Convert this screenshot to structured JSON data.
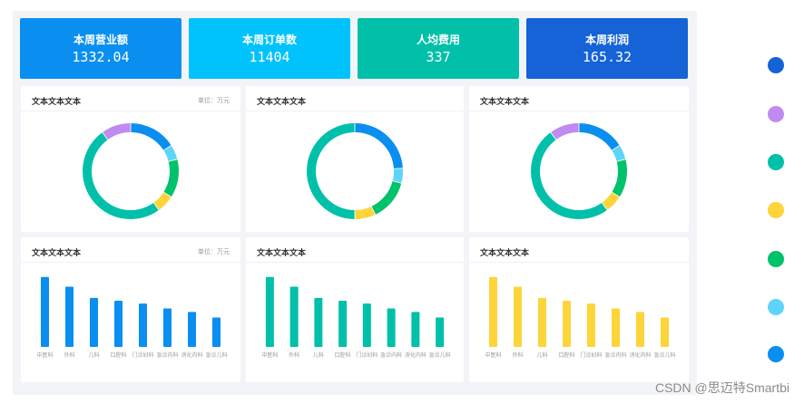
{
  "kpis": [
    {
      "title": "本周营业额",
      "value": "1332.04",
      "color": "#0a8ff0"
    },
    {
      "title": "本周订单数",
      "value": "11404",
      "color": "#00c2fc"
    },
    {
      "title": "人均费用",
      "value": "337",
      "color": "#00c0a9"
    },
    {
      "title": "本周利润",
      "value": "165.32",
      "color": "#1563d6"
    }
  ],
  "donut_cards": [
    {
      "title": "文本文本文本",
      "unit": "单位：万元"
    },
    {
      "title": "文本文本文本",
      "unit": ""
    },
    {
      "title": "文本文本文本",
      "unit": ""
    }
  ],
  "bar_cards": [
    {
      "title": "文本文本文本",
      "unit": "单位：万元",
      "color": "#0a8ff0"
    },
    {
      "title": "文本文本文本",
      "unit": "",
      "color": "#00c0a9"
    },
    {
      "title": "文本文本文本",
      "unit": "",
      "color": "#fdd43a"
    }
  ],
  "chart_data": [
    {
      "type": "pie",
      "donut": true,
      "slices": [
        {
          "value": 16,
          "color": "#0a8ff0"
        },
        {
          "value": 5,
          "color": "#5fd4fb"
        },
        {
          "value": 13,
          "color": "#00c26a"
        },
        {
          "value": 6,
          "color": "#fdd43a"
        },
        {
          "value": 50,
          "color": "#00c0a9"
        },
        {
          "value": 10,
          "color": "#c18af0"
        }
      ]
    },
    {
      "type": "pie",
      "donut": true,
      "slices": [
        {
          "value": 24,
          "color": "#0a8ff0"
        },
        {
          "value": 5,
          "color": "#5fd4fb"
        },
        {
          "value": 14,
          "color": "#00c26a"
        },
        {
          "value": 7,
          "color": "#fdd43a"
        },
        {
          "value": 50,
          "color": "#00c0a9"
        }
      ]
    },
    {
      "type": "pie",
      "donut": true,
      "slices": [
        {
          "value": 16,
          "color": "#0a8ff0"
        },
        {
          "value": 5,
          "color": "#5fd4fb"
        },
        {
          "value": 13,
          "color": "#00c26a"
        },
        {
          "value": 6,
          "color": "#fdd43a"
        },
        {
          "value": 50,
          "color": "#00c0a9"
        },
        {
          "value": 10,
          "color": "#c18af0"
        }
      ]
    },
    {
      "type": "bar",
      "categories": [
        "中医科",
        "外科",
        "儿科",
        "口腔科",
        "门诊妇科",
        "急诊内科",
        "消化内科",
        "急诊儿科"
      ],
      "values": [
        100,
        86,
        70,
        66,
        62,
        55,
        50,
        42
      ],
      "ylim": [
        0,
        110
      ],
      "color": "#0a8ff0"
    },
    {
      "type": "bar",
      "categories": [
        "中医科",
        "外科",
        "儿科",
        "口腔科",
        "门诊妇科",
        "急诊内科",
        "消化内科",
        "急诊儿科"
      ],
      "values": [
        100,
        86,
        70,
        66,
        62,
        55,
        50,
        42
      ],
      "ylim": [
        0,
        110
      ],
      "color": "#00c0a9"
    },
    {
      "type": "bar",
      "categories": [
        "中医科",
        "外科",
        "儿科",
        "口腔科",
        "门诊妇科",
        "急诊内科",
        "消化内科",
        "急诊儿科"
      ],
      "values": [
        100,
        86,
        70,
        66,
        62,
        55,
        50,
        42
      ],
      "ylim": [
        0,
        110
      ],
      "color": "#fdd43a"
    }
  ],
  "palette": [
    "#1563d6",
    "#c18af0",
    "#00c0a9",
    "#fdd43a",
    "#00c26a",
    "#5fd4fb",
    "#0a8ff0"
  ],
  "watermark": "CSDN @思迈特Smartbi"
}
